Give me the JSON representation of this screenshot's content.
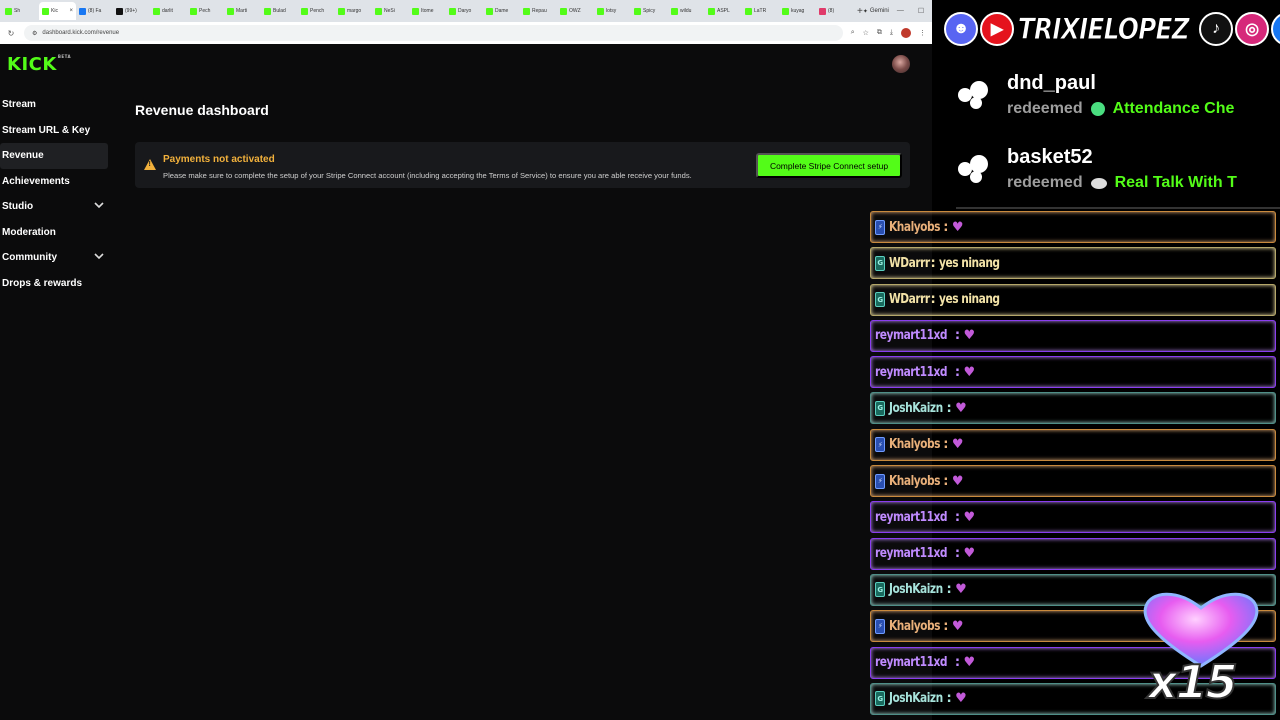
{
  "browser": {
    "tabs": [
      {
        "label": "Sh",
        "icon": "kick-favicon",
        "color": "#53fc18",
        "active": false
      },
      {
        "label": "Kic",
        "icon": "kick-favicon",
        "color": "#53fc18",
        "active": true
      },
      {
        "label": "(8) Fa",
        "icon": "facebook-favicon",
        "color": "#1877f2",
        "active": false
      },
      {
        "label": "(99+)",
        "icon": "tiktok-favicon",
        "color": "#111111",
        "active": false
      },
      {
        "label": "darlit",
        "icon": "kick-favicon",
        "color": "#53fc18",
        "active": false
      },
      {
        "label": "Pech",
        "icon": "kick-favicon",
        "color": "#53fc18",
        "active": false
      },
      {
        "label": "Marti",
        "icon": "kick-favicon",
        "color": "#53fc18",
        "active": false
      },
      {
        "label": "Bulad",
        "icon": "kick-favicon",
        "color": "#53fc18",
        "active": false
      },
      {
        "label": "Pench",
        "icon": "kick-favicon",
        "color": "#53fc18",
        "active": false
      },
      {
        "label": "margo",
        "icon": "kick-favicon",
        "color": "#53fc18",
        "active": false
      },
      {
        "label": "NeSi",
        "icon": "kick-favicon",
        "color": "#53fc18",
        "active": false
      },
      {
        "label": "Itome",
        "icon": "kick-favicon",
        "color": "#53fc18",
        "active": false
      },
      {
        "label": "Daryo",
        "icon": "kick-favicon",
        "color": "#53fc18",
        "active": false
      },
      {
        "label": "Dame",
        "icon": "kick-favicon",
        "color": "#53fc18",
        "active": false
      },
      {
        "label": "Repau",
        "icon": "kick-favicon",
        "color": "#53fc18",
        "active": false
      },
      {
        "label": "OWZ",
        "icon": "kick-favicon",
        "color": "#53fc18",
        "active": false
      },
      {
        "label": "lotsy",
        "icon": "kick-favicon",
        "color": "#53fc18",
        "active": false
      },
      {
        "label": "Spicy",
        "icon": "kick-favicon",
        "color": "#53fc18",
        "active": false
      },
      {
        "label": "wildu",
        "icon": "kick-favicon",
        "color": "#53fc18",
        "active": false
      },
      {
        "label": "ASPL",
        "icon": "kick-favicon",
        "color": "#53fc18",
        "active": false
      },
      {
        "label": "LaTR",
        "icon": "kick-favicon",
        "color": "#53fc18",
        "active": false
      },
      {
        "label": "kuyag",
        "icon": "kick-favicon",
        "color": "#53fc18",
        "active": false
      },
      {
        "label": "(8)",
        "icon": "record-favicon",
        "color": "#e03a6a",
        "active": false
      }
    ],
    "new_tab": "+",
    "gemini_tab": "Gemini",
    "url": "dashboard.kick.com/revenue"
  },
  "kick": {
    "logo": "KICK",
    "logo_tag": "BETA",
    "sidebar": [
      {
        "label": "Stream",
        "active": false,
        "expandable": false
      },
      {
        "label": "Stream URL & Key",
        "active": false,
        "expandable": false
      },
      {
        "label": "Revenue",
        "active": true,
        "expandable": false
      },
      {
        "label": "Achievements",
        "active": false,
        "expandable": false
      },
      {
        "label": "Studio",
        "active": false,
        "expandable": true
      },
      {
        "label": "Moderation",
        "active": false,
        "expandable": false
      },
      {
        "label": "Community",
        "active": false,
        "expandable": true
      },
      {
        "label": "Drops & rewards",
        "active": false,
        "expandable": false
      }
    ],
    "page_title": "Revenue dashboard",
    "alert": {
      "title": "Payments not activated",
      "text": "Please make sure to complete the setup of your Stripe Connect account (including accepting the Terms of Service) to ensure you are able receive your funds.",
      "button": "Complete Stripe Connect setup"
    },
    "accent": "#53fc18",
    "warning": "#f2b13c"
  },
  "overlay": {
    "streamer": "TRIXIELOPEZ",
    "socials": [
      {
        "icon": "discord-icon",
        "color": "#5865f2",
        "glyph": "☻"
      },
      {
        "icon": "youtube-icon",
        "color": "#e5131d",
        "glyph": "▶"
      },
      {
        "icon": "tiktok-icon",
        "color": "#111111",
        "glyph": "♪"
      },
      {
        "icon": "instagram-icon",
        "color": "#d6287a",
        "glyph": "◎"
      },
      {
        "icon": "facebook-icon",
        "color": "#1877f2",
        "glyph": "f"
      }
    ],
    "redemptions": [
      {
        "user": "dnd_paul",
        "verb": "redeemed",
        "reward": "Attendance Che",
        "marker": "green-dot"
      },
      {
        "user": "basket52",
        "verb": "redeemed",
        "reward": "Real Talk With T",
        "marker": "chat-bubble"
      }
    ],
    "chat": [
      {
        "user": "Khalyobs",
        "badge": "kx",
        "style": "orange",
        "message": ""
      },
      {
        "user": "WDarrr",
        "badge": "gf",
        "style": "yellow",
        "message": "yes ninang"
      },
      {
        "user": "WDarrr",
        "badge": "gf",
        "style": "yellow",
        "message": "yes ninang"
      },
      {
        "user": "reymart11xd",
        "badge": "",
        "style": "purple",
        "message": ""
      },
      {
        "user": "reymart11xd",
        "badge": "",
        "style": "purple",
        "message": ""
      },
      {
        "user": "JoshKaizn",
        "badge": "gf",
        "style": "teal",
        "message": ""
      },
      {
        "user": "Khalyobs",
        "badge": "kx",
        "style": "orange",
        "message": ""
      },
      {
        "user": "Khalyobs",
        "badge": "kx",
        "style": "orange",
        "message": ""
      },
      {
        "user": "reymart11xd",
        "badge": "",
        "style": "purple",
        "message": ""
      },
      {
        "user": "reymart11xd",
        "badge": "",
        "style": "purple",
        "message": ""
      },
      {
        "user": "JoshKaizn",
        "badge": "gf",
        "style": "teal",
        "message": ""
      },
      {
        "user": "Khalyobs",
        "badge": "kx",
        "style": "orange",
        "message": ""
      },
      {
        "user": "reymart11xd",
        "badge": "",
        "style": "purple",
        "message": ""
      },
      {
        "user": "JoshKaizn",
        "badge": "gf",
        "style": "teal",
        "message": ""
      }
    ],
    "heart_counter": "x15"
  }
}
